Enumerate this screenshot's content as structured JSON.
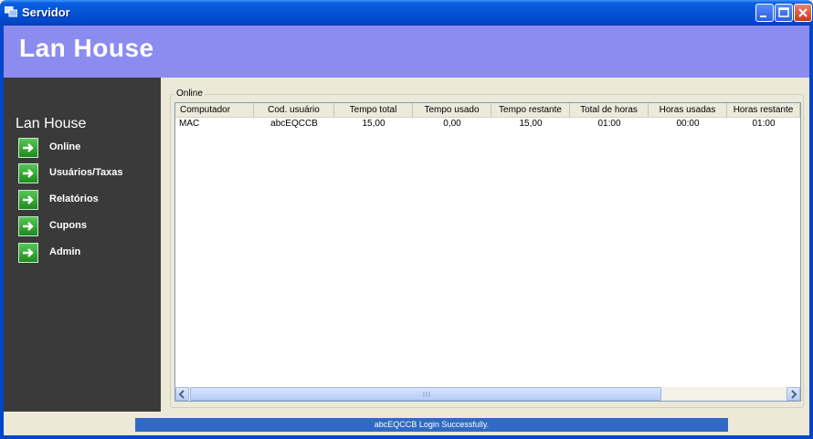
{
  "window": {
    "title": "Servidor",
    "controls": [
      "minimize-icon",
      "maximize-icon",
      "close-icon"
    ]
  },
  "header": {
    "title": "Lan House"
  },
  "sidebar": {
    "title": "Lan House",
    "items": [
      {
        "label": "Online",
        "icon": "arrow-right-icon"
      },
      {
        "label": "Usuários/Taxas",
        "icon": "arrow-right-icon"
      },
      {
        "label": "Relatórios",
        "icon": "arrow-right-icon"
      },
      {
        "label": "Cupons",
        "icon": "arrow-right-icon"
      },
      {
        "label": "Admin",
        "icon": "arrow-right-icon"
      }
    ]
  },
  "main": {
    "group_label": "Online",
    "columns": [
      "Computador",
      "Cod. usuário",
      "Tempo total",
      "Tempo usado",
      "Tempo restante",
      "Total de horas",
      "Horas usadas",
      "Horas restante"
    ],
    "rows": [
      [
        "MAC",
        "abcEQCCB",
        "15,00",
        "0,00",
        "15,00",
        "01:00",
        "00:00",
        "01:00"
      ]
    ]
  },
  "status": {
    "message": "abcEQCCB Login Successfully."
  },
  "colors": {
    "header_bg": "#8c8cf0",
    "sidebar_bg": "#3a3a3a",
    "status_bg": "#3169c6",
    "titlebar": "#0453d6"
  }
}
